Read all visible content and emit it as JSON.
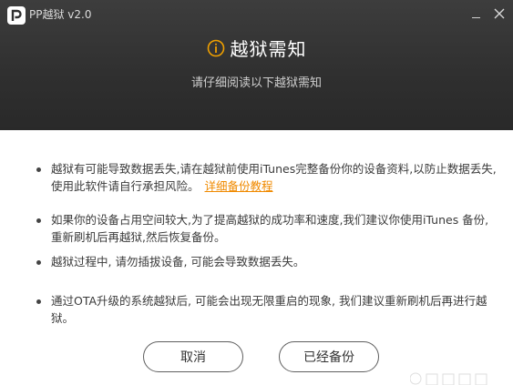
{
  "window": {
    "title": "PP越狱 v2.0"
  },
  "header": {
    "heading": "越狱需知",
    "subtitle": "请仔细阅读以下越狱需知"
  },
  "notices": [
    {
      "text": "越狱有可能导致数据丢失,请在越狱前使用iTunes完整备份你的设备资料,以防止数据丢失,使用此软件请自行承担风险。",
      "link": "详细备份教程"
    },
    {
      "text": "如果你的设备占用空间较大,为了提高越狱的成功率和速度,我们建议你使用iTunes 备份,重新刷机后再越狱,然后恢复备份。"
    },
    {
      "text": "越狱过程中, 请勿插拔设备, 可能会导致数据丢失。"
    },
    {
      "text": "通过OTA升级的系统越狱后, 可能会出现无限重启的现象, 我们建议重新刷机后再进行越狱。"
    }
  ],
  "buttons": {
    "cancel": "取消",
    "backed_up": "已经备份"
  },
  "colors": {
    "header_bg": "#2f2f2f",
    "link": "#f08a00",
    "accent": "#f0a000"
  },
  "icons": {
    "logo": "pp-logo-icon",
    "heading": "info-icon",
    "minimize": "minimize-icon",
    "close": "close-icon"
  }
}
